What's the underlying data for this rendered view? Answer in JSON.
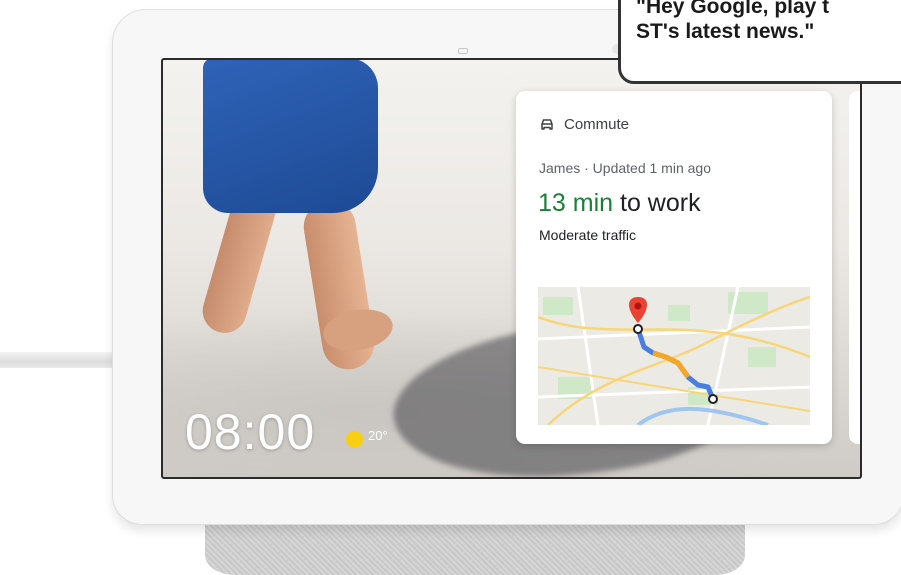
{
  "device": {
    "clock": "08:00",
    "temperature": "20°",
    "weather_icon": "sun-icon"
  },
  "card": {
    "icon": "car-icon",
    "title": "Commute",
    "subtitle": "James · Updated 1 min ago",
    "duration": "13 min",
    "destination": " to work",
    "traffic": "Moderate traffic"
  },
  "callout": {
    "line1": "\"Hey Google, play t",
    "line2": "ST's latest news.\""
  },
  "colors": {
    "duration_green": "#188038",
    "route_blue": "#4a7de0",
    "route_orange": "#f5a623",
    "pin_red": "#ea4335",
    "sun_yellow": "#f8cf12"
  }
}
